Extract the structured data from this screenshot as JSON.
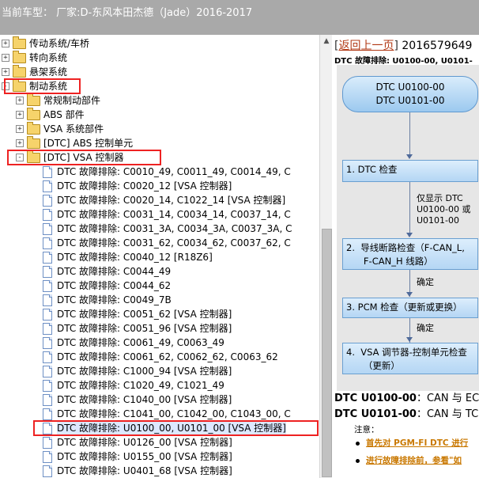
{
  "header": {
    "title": "当前车型：  厂家:D-东风本田杰德（Jade）2016-2017"
  },
  "tree": {
    "top_folders": [
      {
        "pm": "+",
        "label": "传动系统/车桥"
      },
      {
        "pm": "+",
        "label": "转向系统"
      },
      {
        "pm": "+",
        "label": "悬架系统"
      },
      {
        "pm": "-",
        "label": "制动系统"
      }
    ],
    "sub_folders": [
      {
        "pm": "+",
        "label": "常规制动部件"
      },
      {
        "pm": "+",
        "label": "ABS 部件"
      },
      {
        "pm": "+",
        "label": "VSA 系统部件"
      },
      {
        "pm": "+",
        "label": "[DTC] ABS 控制单元"
      },
      {
        "pm": "-",
        "label": "[DTC] VSA 控制器"
      }
    ],
    "docs": [
      "DTC 故障排除: C0010_49, C0011_49, C0014_49, C",
      "DTC 故障排除: C0020_12 [VSA 控制器]",
      "DTC 故障排除: C0020_14, C1022_14 [VSA 控制器]",
      "DTC 故障排除: C0031_14, C0034_14, C0037_14, C",
      "DTC 故障排除: C0031_3A, C0034_3A, C0037_3A, C",
      "DTC 故障排除: C0031_62, C0034_62, C0037_62, C",
      "DTC 故障排除: C0040_12 [R18Z6]",
      "DTC 故障排除: C0044_49",
      "DTC 故障排除: C0044_62",
      "DTC 故障排除: C0049_7B",
      "DTC 故障排除: C0051_62 [VSA 控制器]",
      "DTC 故障排除: C0051_96 [VSA 控制器]",
      "DTC 故障排除: C0061_49, C0063_49",
      "DTC 故障排除: C0061_62, C0062_62, C0063_62",
      "DTC 故障排除: C1000_94 [VSA 控制器]",
      "DTC 故障排除: C1020_49, C1021_49",
      "DTC 故障排除: C1040_00 [VSA 控制器]",
      "DTC 故障排除: C1041_00, C1042_00, C1043_00, C",
      "DTC 故障排除: U0100_00, U0101_00 [VSA 控制器]",
      "DTC 故障排除: U0126_00 [VSA 控制器]",
      "DTC 故障排除: U0155_00 [VSA 控制器]",
      "DTC 故障排除: U0401_68 [VSA 控制器]"
    ],
    "selected_index": 18
  },
  "content": {
    "back_link": "返回上一页",
    "doc_number": "2016579649",
    "dtc_heading": "DTC 故障排除: U0100-00, U0101-",
    "flow": {
      "start": [
        "DTC U0100-00",
        "DTC U0101-00"
      ],
      "steps": [
        "1.  DTC 检查",
        "2.  导线断路检查（F-CAN_L,\n      F-CAN_H 线路）",
        "3.  PCM 检查（更新或更换）",
        "4.  VSA 调节器-控制单元检查\n      （更新）"
      ],
      "note1": "仅显示 DTC\nU0100-00 或\nU0101-00",
      "note2": "确定",
      "note3": "确定"
    },
    "codes": [
      {
        "code": "DTC U0100-00",
        "desc": "：CAN 与 EC"
      },
      {
        "code": "DTC U0101-00",
        "desc": "：CAN 与 TC"
      }
    ],
    "attention": "注意：",
    "bullets": [
      "首先对 PGM-FI DTC 进行",
      "进行故障排除前，参看\"如"
    ]
  },
  "colors": {
    "highlight": "#e22222",
    "link": "#b23a16",
    "warning_text": "#c97800"
  }
}
